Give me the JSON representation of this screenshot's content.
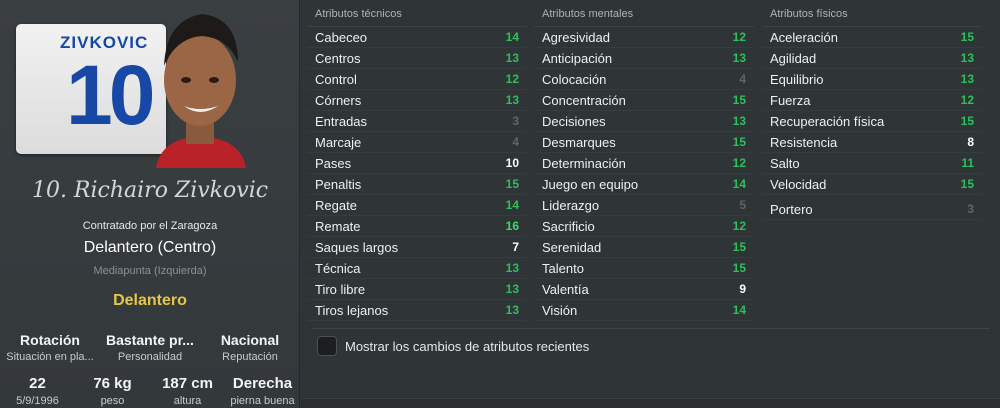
{
  "player": {
    "shirt_name": "ZIVKOVIC",
    "shirt_number": "10",
    "full_name": "10. Richairo Zivkovic",
    "contract": "Contratado por el Zaragoza",
    "position": "Delantero (Centro)",
    "secondary_position": "Mediapunta (Izquierda)",
    "role": "Delantero"
  },
  "info": [
    {
      "value": "Rotación",
      "label": "Situación en pla..."
    },
    {
      "value": "Bastante pr...",
      "label": "Personalidad"
    },
    {
      "value": "Nacional",
      "label": "Reputación"
    }
  ],
  "details": [
    {
      "value": "22",
      "label": "5/9/1996"
    },
    {
      "value": "76 kg",
      "label": "peso"
    },
    {
      "value": "187 cm",
      "label": "altura"
    },
    {
      "value": "Derecha",
      "label": "pierna buena"
    }
  ],
  "technical": {
    "header": "Atributos técnicos",
    "items": [
      {
        "name": "Cabeceo",
        "value": "14"
      },
      {
        "name": "Centros",
        "value": "13"
      },
      {
        "name": "Control",
        "value": "12"
      },
      {
        "name": "Córners",
        "value": "13"
      },
      {
        "name": "Entradas",
        "value": "3"
      },
      {
        "name": "Marcaje",
        "value": "4"
      },
      {
        "name": "Pases",
        "value": "10"
      },
      {
        "name": "Penaltis",
        "value": "15"
      },
      {
        "name": "Regate",
        "value": "14"
      },
      {
        "name": "Remate",
        "value": "16"
      },
      {
        "name": "Saques largos",
        "value": "7"
      },
      {
        "name": "Técnica",
        "value": "13"
      },
      {
        "name": "Tiro libre",
        "value": "13"
      },
      {
        "name": "Tiros lejanos",
        "value": "13"
      }
    ]
  },
  "mental": {
    "header": "Atributos mentales",
    "items": [
      {
        "name": "Agresividad",
        "value": "12"
      },
      {
        "name": "Anticipación",
        "value": "13"
      },
      {
        "name": "Colocación",
        "value": "4"
      },
      {
        "name": "Concentración",
        "value": "15"
      },
      {
        "name": "Decisiones",
        "value": "13"
      },
      {
        "name": "Desmarques",
        "value": "15"
      },
      {
        "name": "Determinación",
        "value": "12"
      },
      {
        "name": "Juego en equipo",
        "value": "14"
      },
      {
        "name": "Liderazgo",
        "value": "5"
      },
      {
        "name": "Sacrificio",
        "value": "12"
      },
      {
        "name": "Serenidad",
        "value": "15"
      },
      {
        "name": "Talento",
        "value": "15"
      },
      {
        "name": "Valentía",
        "value": "9"
      },
      {
        "name": "Visión",
        "value": "14"
      }
    ]
  },
  "physical": {
    "header": "Atributos físicos",
    "items": [
      {
        "name": "Aceleración",
        "value": "15"
      },
      {
        "name": "Agilidad",
        "value": "13"
      },
      {
        "name": "Equilibrio",
        "value": "13"
      },
      {
        "name": "Fuerza",
        "value": "12"
      },
      {
        "name": "Recuperación física",
        "value": "15"
      },
      {
        "name": "Resistencia",
        "value": "8"
      },
      {
        "name": "Salto",
        "value": "11"
      },
      {
        "name": "Velocidad",
        "value": "15"
      }
    ],
    "goalkeeper": {
      "name": "Portero",
      "value": "3"
    }
  },
  "options": {
    "show_changes_label": "Mostrar los cambios de atributos recientes",
    "show_changes_checked": false
  },
  "colors": {
    "high": "#2fbf5a",
    "very_high": "#33e060",
    "mid": "#ffffff",
    "low": "#5f6569",
    "role": "#e5c646",
    "shirt_blue": "#1748a6"
  }
}
